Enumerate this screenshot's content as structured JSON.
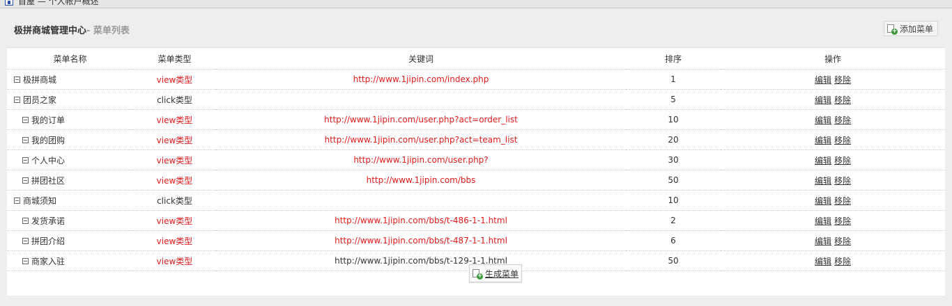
{
  "topbar": {
    "breadcrumb": "首屋 — 个人帐户概述"
  },
  "header": {
    "title": "极拼商城管理中心",
    "subtitle": "- 菜单列表",
    "add_button": "添加菜单"
  },
  "table": {
    "columns": [
      "菜单名称",
      "菜单类型",
      "关键词",
      "排序",
      "操作"
    ],
    "rows": [
      {
        "name": "极拼商城",
        "type": "view类型",
        "keyword": "http://www.1jipin.com/index.php",
        "sort": "1",
        "level": 0,
        "keyword_red": true,
        "type_red": true
      },
      {
        "name": "团员之家",
        "type": "click类型",
        "keyword": "",
        "sort": "5",
        "level": 0,
        "keyword_red": false,
        "type_red": false
      },
      {
        "name": "我的订单",
        "type": "view类型",
        "keyword": "http://www.1jipin.com/user.php?act=order_list",
        "sort": "10",
        "level": 1,
        "keyword_red": true,
        "type_red": true
      },
      {
        "name": "我的团购",
        "type": "view类型",
        "keyword": "http://www.1jipin.com/user.php?act=team_list",
        "sort": "20",
        "level": 1,
        "keyword_red": true,
        "type_red": true
      },
      {
        "name": "个人中心",
        "type": "view类型",
        "keyword": "http://www.1jipin.com/user.php?",
        "sort": "30",
        "level": 1,
        "keyword_red": true,
        "type_red": true
      },
      {
        "name": "拼团社区",
        "type": "view类型",
        "keyword": "http://www.1jipin.com/bbs",
        "sort": "50",
        "level": 1,
        "keyword_red": true,
        "type_red": true
      },
      {
        "name": "商城须知",
        "type": "click类型",
        "keyword": "",
        "sort": "10",
        "level": 0,
        "keyword_red": false,
        "type_red": false
      },
      {
        "name": "发货承诺",
        "type": "view类型",
        "keyword": "http://www.1jipin.com/bbs/t-486-1-1.html",
        "sort": "2",
        "level": 1,
        "keyword_red": true,
        "type_red": true
      },
      {
        "name": "拼团介绍",
        "type": "view类型",
        "keyword": "http://www.1jipin.com/bbs/t-487-1-1.html",
        "sort": "6",
        "level": 1,
        "keyword_red": true,
        "type_red": true
      },
      {
        "name": "商家入驻",
        "type": "view类型",
        "keyword": "http://www.1jipin.com/bbs/t-129-1-1.html",
        "sort": "50",
        "level": 1,
        "keyword_red": false,
        "type_red": true
      }
    ],
    "actions": {
      "edit": "编辑",
      "remove": "移除"
    }
  },
  "footer": {
    "generate_button": "生成菜单"
  },
  "colors": {
    "accent_red": "#e01b1b",
    "text": "#333333",
    "background": "#eeeeee"
  }
}
